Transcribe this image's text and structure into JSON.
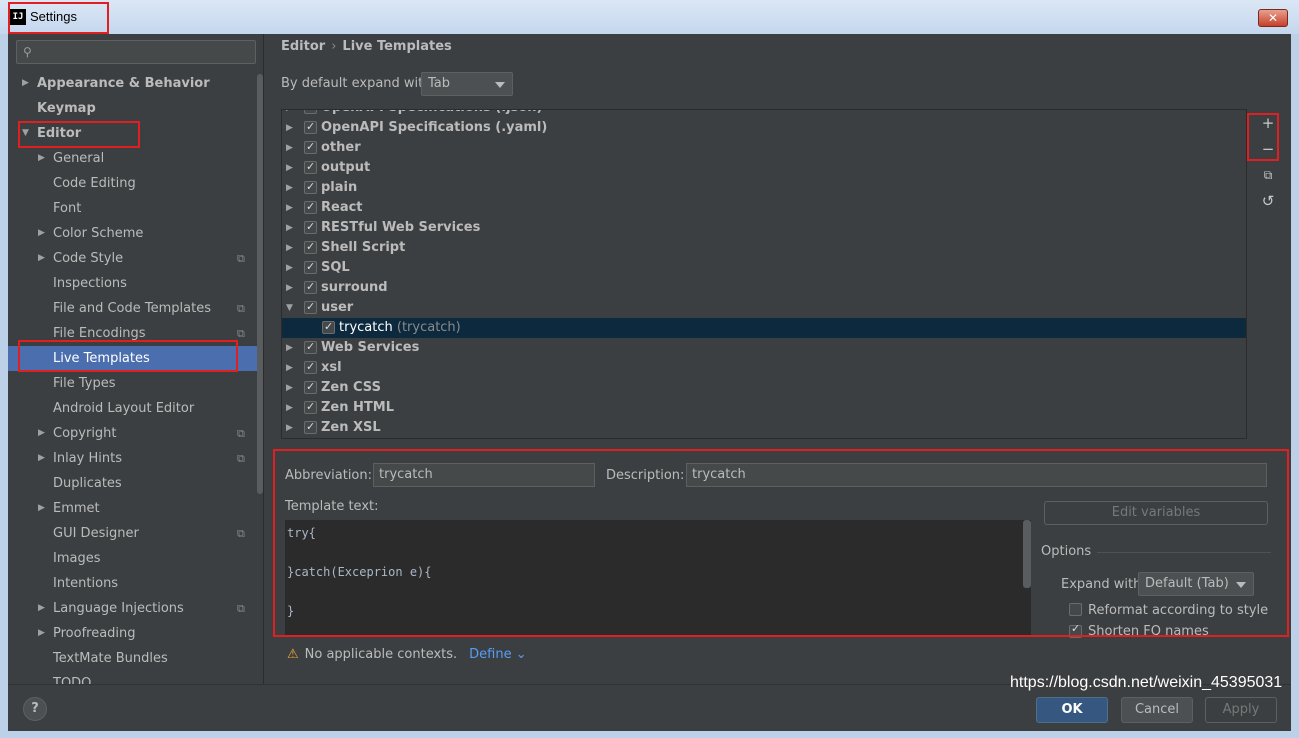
{
  "window": {
    "title": "Settings",
    "app_icon": "IJ",
    "close_glyph": "✕"
  },
  "sidebar": {
    "search_placeholder": "",
    "items": [
      {
        "label": "Appearance & Behavior",
        "arrow": "▶"
      },
      {
        "label": "Keymap",
        "arrow": ""
      },
      {
        "label": "Editor",
        "arrow": "▼"
      },
      {
        "label": "General",
        "arrow": "▶"
      },
      {
        "label": "Code Editing",
        "arrow": ""
      },
      {
        "label": "Font",
        "arrow": ""
      },
      {
        "label": "Color Scheme",
        "arrow": "▶"
      },
      {
        "label": "Code Style",
        "arrow": "▶"
      },
      {
        "label": "Inspections",
        "arrow": ""
      },
      {
        "label": "File and Code Templates",
        "arrow": ""
      },
      {
        "label": "File Encodings",
        "arrow": ""
      },
      {
        "label": "Live Templates",
        "arrow": ""
      },
      {
        "label": "File Types",
        "arrow": ""
      },
      {
        "label": "Android Layout Editor",
        "arrow": ""
      },
      {
        "label": "Copyright",
        "arrow": "▶"
      },
      {
        "label": "Inlay Hints",
        "arrow": "▶"
      },
      {
        "label": "Duplicates",
        "arrow": ""
      },
      {
        "label": "Emmet",
        "arrow": "▶"
      },
      {
        "label": "GUI Designer",
        "arrow": ""
      },
      {
        "label": "Images",
        "arrow": ""
      },
      {
        "label": "Intentions",
        "arrow": ""
      },
      {
        "label": "Language Injections",
        "arrow": "▶"
      },
      {
        "label": "Proofreading",
        "arrow": "▶"
      },
      {
        "label": "TextMate Bundles",
        "arrow": ""
      },
      {
        "label": "TODO",
        "arrow": ""
      }
    ],
    "copy_glyph": "⧉"
  },
  "breadcrumb": {
    "section": "Editor",
    "separator": "›",
    "page": "Live Templates"
  },
  "expand": {
    "label": "By default expand with",
    "value": "Tab"
  },
  "template_groups": [
    {
      "label": "OpenAPI Specifications (.json)",
      "arrow": "▶",
      "checked": true
    },
    {
      "label": "OpenAPI Specifications (.yaml)",
      "arrow": "▶",
      "checked": true
    },
    {
      "label": "other",
      "arrow": "▶",
      "checked": true
    },
    {
      "label": "output",
      "arrow": "▶",
      "checked": true
    },
    {
      "label": "plain",
      "arrow": "▶",
      "checked": true
    },
    {
      "label": "React",
      "arrow": "▶",
      "checked": true
    },
    {
      "label": "RESTful Web Services",
      "arrow": "▶",
      "checked": true
    },
    {
      "label": "Shell Script",
      "arrow": "▶",
      "checked": true
    },
    {
      "label": "SQL",
      "arrow": "▶",
      "checked": true
    },
    {
      "label": "surround",
      "arrow": "▶",
      "checked": true
    },
    {
      "label": "user",
      "arrow": "▼",
      "checked": true
    },
    {
      "label": "trycatch",
      "sub": "(trycatch)",
      "arrow": "",
      "checked": true,
      "child": true,
      "selected": true
    },
    {
      "label": "Web Services",
      "arrow": "▶",
      "checked": true
    },
    {
      "label": "xsl",
      "arrow": "▶",
      "checked": true
    },
    {
      "label": "Zen CSS",
      "arrow": "▶",
      "checked": true
    },
    {
      "label": "Zen HTML",
      "arrow": "▶",
      "checked": true
    },
    {
      "label": "Zen XSL",
      "arrow": "▶",
      "checked": true
    }
  ],
  "toolbar": {
    "add_glyph": "+",
    "remove_glyph": "−",
    "copy_glyph": "⧉",
    "restore_glyph": "↺"
  },
  "detail": {
    "abbreviation_label": "Abbreviation:",
    "abbreviation_value": "trycatch",
    "description_label": "Description:",
    "description_value": "trycatch",
    "template_text_label": "Template text:",
    "template_lines": [
      "try{",
      "",
      "}catch(Exceprion e){",
      "",
      "}"
    ],
    "edit_variables_label": "Edit variables",
    "options_title": "Options",
    "expand_with_label": "Expand with",
    "expand_with_value": "Default (Tab)",
    "reformat_label": "Reformat according to style",
    "reformat_checked": false,
    "shorten_label": "Shorten FQ names",
    "shorten_checked": true
  },
  "context": {
    "warning_icon": "⚠",
    "warning_text": "No applicable contexts.",
    "define_label": "Define",
    "define_caret": "⌄"
  },
  "footer": {
    "help_label": "?",
    "ok_label": "OK",
    "cancel_label": "Cancel",
    "apply_label": "Apply",
    "watermark": "https://blog.csdn.net/weixin_45395031"
  },
  "colors": {
    "accent_selection": "#4b6eaf",
    "tree_selection": "#0d293e",
    "ok_button": "#365880",
    "annotation_red": "#e02020",
    "link": "#589df6",
    "warning": "#f0a732"
  }
}
